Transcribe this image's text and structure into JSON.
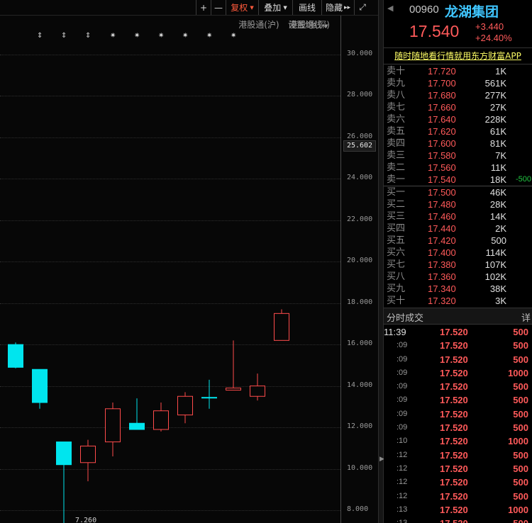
{
  "toolbar": {
    "plus": "+",
    "minus": "—",
    "fuquan": "复权",
    "diejia": "叠加",
    "huaxian": "画线",
    "yincang": "隐藏",
    "play_icon": "▸▸",
    "expand_icon": "⤢"
  },
  "links": {
    "hgt_sh": "港股通(沪)",
    "hgt_sz": "港股通(深)",
    "setting_ma": "设置均线"
  },
  "markers": [
    "⇕",
    "⇕",
    "⇕",
    "✷",
    "✷",
    "✷",
    "✷",
    "✷",
    "✷"
  ],
  "chart_data": {
    "type": "candlestick",
    "y_ticks": [
      "30.000",
      "28.000",
      "26.000",
      "24.000",
      "22.000",
      "20.000",
      "18.000",
      "16.000",
      "14.000",
      "12.000",
      "10.000",
      "8.000"
    ],
    "current_price_label": "25.602",
    "low_label": "7.260",
    "candles": [
      {
        "open": 14.9,
        "close": 16.0,
        "high": 16.1,
        "low": 14.85,
        "dir": "down"
      },
      {
        "open": 14.8,
        "close": 13.2,
        "high": 14.8,
        "low": 12.9,
        "dir": "down"
      },
      {
        "open": 11.3,
        "close": 10.2,
        "high": 11.3,
        "low": 7.26,
        "dir": "down"
      },
      {
        "open": 10.3,
        "close": 11.1,
        "high": 11.4,
        "low": 9.4,
        "dir": "up"
      },
      {
        "open": 11.3,
        "close": 12.9,
        "high": 13.2,
        "low": 10.6,
        "dir": "up"
      },
      {
        "open": 12.2,
        "close": 11.9,
        "high": 13.4,
        "low": 11.9,
        "dir": "down"
      },
      {
        "open": 11.9,
        "close": 12.8,
        "high": 13.2,
        "low": 11.8,
        "dir": "up"
      },
      {
        "open": 12.6,
        "close": 13.5,
        "high": 13.7,
        "low": 12.2,
        "dir": "up"
      },
      {
        "open": 13.45,
        "close": 13.45,
        "high": 14.3,
        "low": 12.9,
        "dir": "flat"
      },
      {
        "open": 13.8,
        "close": 13.9,
        "high": 16.2,
        "low": 13.8,
        "dir": "up"
      },
      {
        "open": 13.5,
        "close": 14.0,
        "high": 14.6,
        "low": 13.3,
        "dir": "up"
      },
      {
        "open": 16.2,
        "close": 17.5,
        "high": 17.7,
        "low": 16.2,
        "dir": "up"
      }
    ]
  },
  "quote": {
    "nav_icon": "◀",
    "code": "00960",
    "name": "龙湖集团",
    "price": "17.540",
    "change": "+3.440",
    "change_pct": "+24.40%",
    "promo": "随时随地看行情就用东方财富APP"
  },
  "asks": [
    {
      "label": "卖十",
      "price": "17.720",
      "vol": "1K",
      "chg": ""
    },
    {
      "label": "卖九",
      "price": "17.700",
      "vol": "561K",
      "chg": ""
    },
    {
      "label": "卖八",
      "price": "17.680",
      "vol": "277K",
      "chg": ""
    },
    {
      "label": "卖七",
      "price": "17.660",
      "vol": "27K",
      "chg": ""
    },
    {
      "label": "卖六",
      "price": "17.640",
      "vol": "228K",
      "chg": ""
    },
    {
      "label": "卖五",
      "price": "17.620",
      "vol": "61K",
      "chg": ""
    },
    {
      "label": "卖四",
      "price": "17.600",
      "vol": "81K",
      "chg": ""
    },
    {
      "label": "卖三",
      "price": "17.580",
      "vol": "7K",
      "chg": ""
    },
    {
      "label": "卖二",
      "price": "17.560",
      "vol": "11K",
      "chg": ""
    },
    {
      "label": "卖一",
      "price": "17.540",
      "vol": "18K",
      "chg": "-500"
    }
  ],
  "bids": [
    {
      "label": "买一",
      "price": "17.500",
      "vol": "46K",
      "chg": ""
    },
    {
      "label": "买二",
      "price": "17.480",
      "vol": "28K",
      "chg": ""
    },
    {
      "label": "买三",
      "price": "17.460",
      "vol": "14K",
      "chg": ""
    },
    {
      "label": "买四",
      "price": "17.440",
      "vol": "2K",
      "chg": ""
    },
    {
      "label": "买五",
      "price": "17.420",
      "vol": "500",
      "chg": ""
    },
    {
      "label": "买六",
      "price": "17.400",
      "vol": "114K",
      "chg": ""
    },
    {
      "label": "买七",
      "price": "17.380",
      "vol": "107K",
      "chg": ""
    },
    {
      "label": "买八",
      "price": "17.360",
      "vol": "102K",
      "chg": ""
    },
    {
      "label": "买九",
      "price": "17.340",
      "vol": "38K",
      "chg": ""
    },
    {
      "label": "买十",
      "price": "17.320",
      "vol": "3K",
      "chg": ""
    }
  ],
  "ticks_header": {
    "title": "分时成交",
    "detail": "详"
  },
  "ticks": [
    {
      "time": "11:39",
      "price": "17.520",
      "vol": "500"
    },
    {
      "time": ":09",
      "price": "17.520",
      "vol": "500"
    },
    {
      "time": ":09",
      "price": "17.520",
      "vol": "500"
    },
    {
      "time": ":09",
      "price": "17.520",
      "vol": "1000"
    },
    {
      "time": ":09",
      "price": "17.520",
      "vol": "500"
    },
    {
      "time": ":09",
      "price": "17.520",
      "vol": "500"
    },
    {
      "time": ":09",
      "price": "17.520",
      "vol": "500"
    },
    {
      "time": ":09",
      "price": "17.520",
      "vol": "500"
    },
    {
      "time": ":10",
      "price": "17.520",
      "vol": "1000"
    },
    {
      "time": ":12",
      "price": "17.520",
      "vol": "500"
    },
    {
      "time": ":12",
      "price": "17.520",
      "vol": "500"
    },
    {
      "time": ":12",
      "price": "17.520",
      "vol": "500"
    },
    {
      "time": ":12",
      "price": "17.520",
      "vol": "500"
    },
    {
      "time": ":13",
      "price": "17.520",
      "vol": "1000"
    },
    {
      "time": ":13",
      "price": "17.520",
      "vol": "500"
    }
  ],
  "colors": {
    "up": "#ff4b4b",
    "down": "#00e5ee",
    "flat": "#00e5ee"
  }
}
